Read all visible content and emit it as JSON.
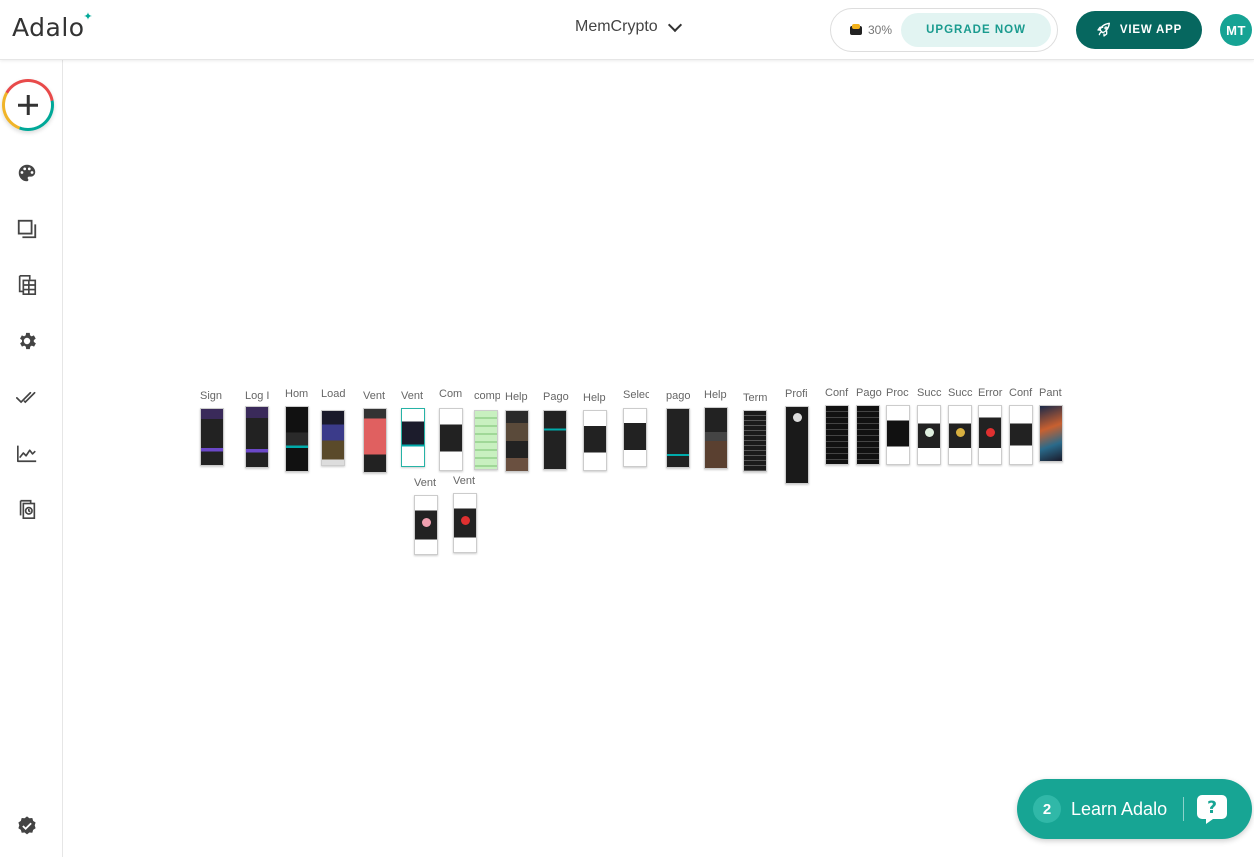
{
  "header": {
    "logo_text": "Adalo",
    "app_name": "MemCrypto",
    "progress_label": "30%",
    "progress_value": 30,
    "upgrade_label": "UPGRADE NOW",
    "view_app_label": "VIEW APP",
    "avatar_initials": "MT"
  },
  "sidebar": {
    "items": [
      {
        "name": "branding",
        "icon": "palette-icon"
      },
      {
        "name": "screens",
        "icon": "screens-icon"
      },
      {
        "name": "database",
        "icon": "database-icon"
      },
      {
        "name": "settings",
        "icon": "gear-icon"
      },
      {
        "name": "publish",
        "icon": "double-check-icon"
      },
      {
        "name": "analytics",
        "icon": "analytics-icon"
      },
      {
        "name": "version",
        "icon": "version-icon"
      },
      {
        "name": "status",
        "icon": "verified-badge-icon"
      }
    ]
  },
  "canvas": {
    "screens": [
      {
        "label": "Sign",
        "style": "purple"
      },
      {
        "label": "Log I",
        "style": "purple"
      },
      {
        "label": "Hom",
        "style": "dark-icons"
      },
      {
        "label": "Load",
        "style": "gallery"
      },
      {
        "label": "Vent",
        "style": "red-list"
      },
      {
        "label": "Vent",
        "style": "light-selected"
      },
      {
        "label": "Com",
        "style": "white-dark"
      },
      {
        "label": "comp",
        "style": "green-grid"
      },
      {
        "label": "Help",
        "style": "photos"
      },
      {
        "label": "Pago",
        "style": "dark-teal"
      },
      {
        "label": "Help",
        "style": "white-dark"
      },
      {
        "label": "Selec",
        "style": "white-buttons"
      },
      {
        "label": "pago",
        "style": "dark"
      },
      {
        "label": "Help",
        "style": "dark-photo"
      },
      {
        "label": "Term",
        "style": "text"
      },
      {
        "label": "Profi",
        "style": "profile"
      },
      {
        "label": "Conf",
        "style": "text-dark"
      },
      {
        "label": "Pago",
        "style": "text-dark"
      },
      {
        "label": "Proc",
        "style": "white-black"
      },
      {
        "label": "Succ",
        "style": "white-success"
      },
      {
        "label": "Succ",
        "style": "white-coin"
      },
      {
        "label": "Error",
        "style": "white-error"
      },
      {
        "label": "Conf",
        "style": "white-confirm"
      },
      {
        "label": "Pant",
        "style": "art"
      },
      {
        "label": "Vent",
        "style": "white-pink"
      },
      {
        "label": "Vent",
        "style": "white-red"
      }
    ]
  },
  "learn": {
    "count": "2",
    "label": "Learn Adalo"
  }
}
